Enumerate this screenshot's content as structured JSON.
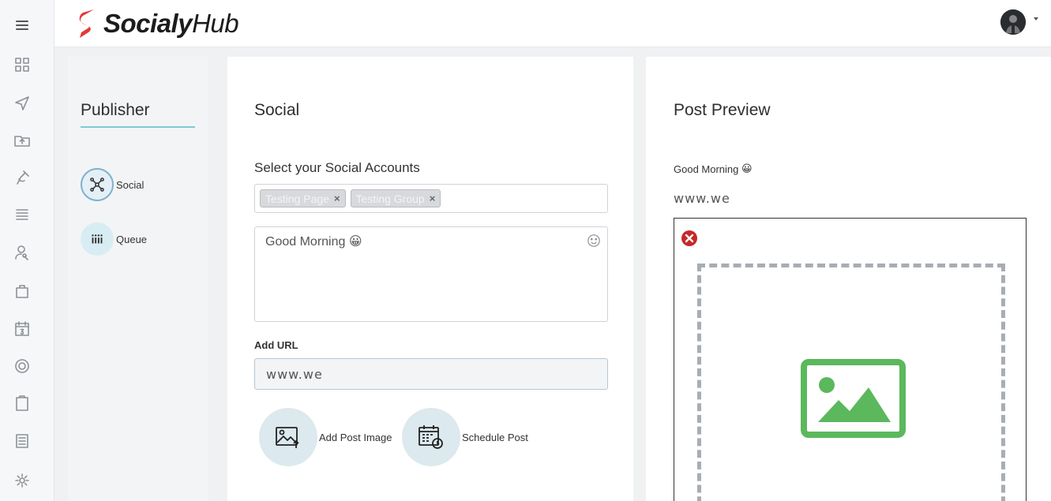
{
  "app": {
    "name_bold": "Socialy",
    "name_light": "Hub",
    "accent_color": "#e53935"
  },
  "rail": {
    "items": [
      "menu-icon",
      "dashboard-icon",
      "send-icon",
      "folder-upload-icon",
      "satellite-icon",
      "list-icon",
      "user-search-icon",
      "bag-icon",
      "calendar-icon",
      "target-icon",
      "clipboard-icon",
      "document-icon",
      "gear-icon"
    ]
  },
  "publisher": {
    "title": "Publisher",
    "nav": [
      {
        "label": "Social",
        "icon": "network-icon",
        "active": true
      },
      {
        "label": "Queue",
        "icon": "queue-icon",
        "active": false
      }
    ]
  },
  "social": {
    "title": "Social",
    "accounts_label": "Select your Social Accounts",
    "selected_accounts": [
      "Testing Page",
      "Testing Group"
    ],
    "remove_symbol": "×",
    "message": "Good Morning 😀",
    "url_label": "Add URL",
    "url_value": "www.we",
    "add_image_label": "Add Post Image",
    "schedule_label": "Schedule Post"
  },
  "preview": {
    "title": "Post Preview",
    "message": "Good Morning",
    "emoji": "😀",
    "url": "www.we"
  }
}
